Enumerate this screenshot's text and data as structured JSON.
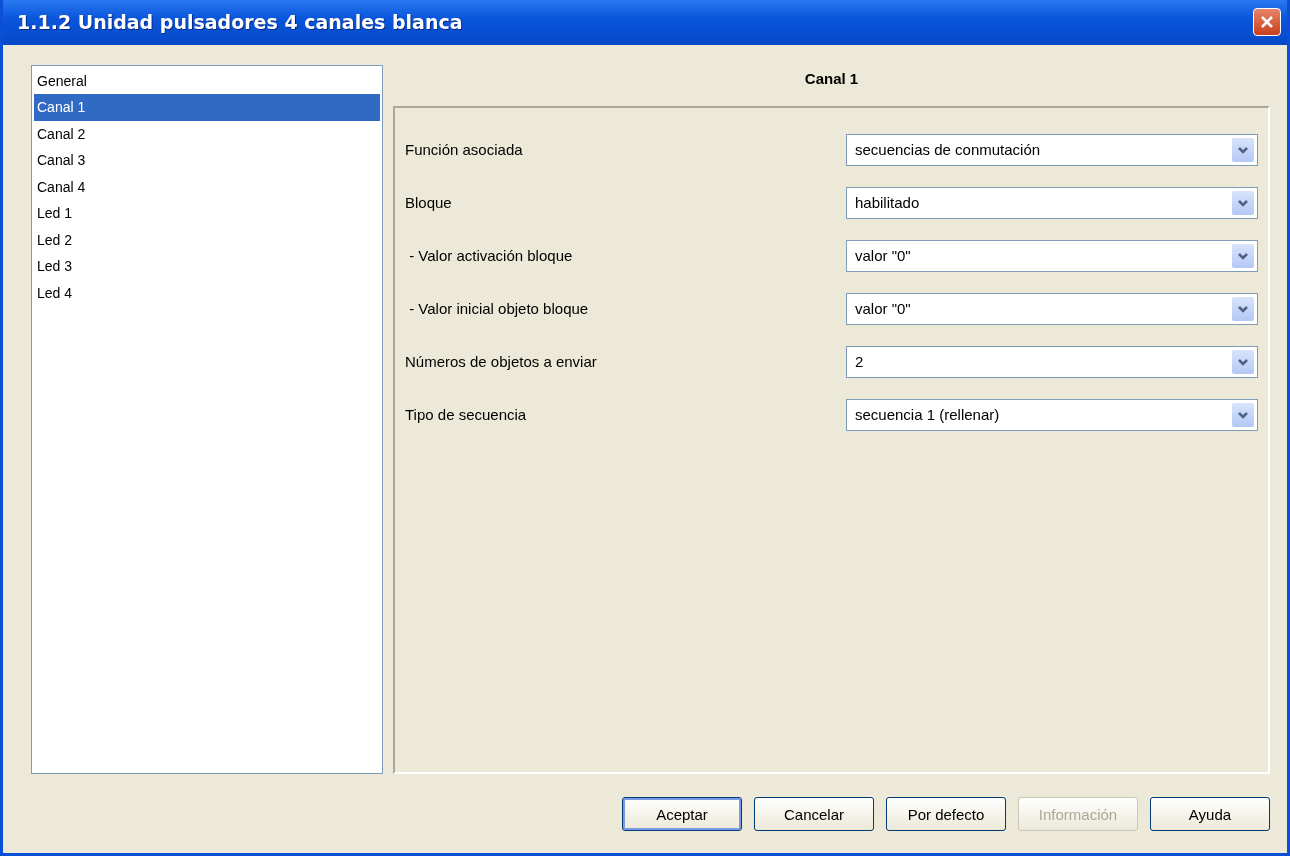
{
  "window": {
    "title": "1.1.2 Unidad pulsadores 4 canales blanca"
  },
  "sidebar": {
    "items": [
      {
        "label": "General",
        "selected": false
      },
      {
        "label": "Canal 1",
        "selected": true
      },
      {
        "label": "Canal 2",
        "selected": false
      },
      {
        "label": "Canal 3",
        "selected": false
      },
      {
        "label": "Canal 4",
        "selected": false
      },
      {
        "label": "Led 1",
        "selected": false
      },
      {
        "label": "Led 2",
        "selected": false
      },
      {
        "label": "Led 3",
        "selected": false
      },
      {
        "label": "Led 4",
        "selected": false
      }
    ]
  },
  "panel": {
    "title": "Canal 1",
    "parameters": [
      {
        "label": "Función asociada",
        "value": "secuencias de conmutación"
      },
      {
        "label": "Bloque",
        "value": "habilitado"
      },
      {
        "label": " - Valor activación bloque",
        "value": "valor \"0\""
      },
      {
        "label": " - Valor inicial objeto bloque",
        "value": "valor \"0\""
      },
      {
        "label": "Números de objetos a enviar",
        "value": "2"
      },
      {
        "label": "Tipo de secuencia",
        "value": "secuencia 1 (rellenar)"
      }
    ]
  },
  "buttons": [
    {
      "label": "Aceptar",
      "disabled": false,
      "default": true
    },
    {
      "label": "Cancelar",
      "disabled": false,
      "default": false
    },
    {
      "label": "Por defecto",
      "disabled": false,
      "default": false
    },
    {
      "label": "Información",
      "disabled": true,
      "default": false
    },
    {
      "label": "Ayuda",
      "disabled": false,
      "default": false
    }
  ]
}
